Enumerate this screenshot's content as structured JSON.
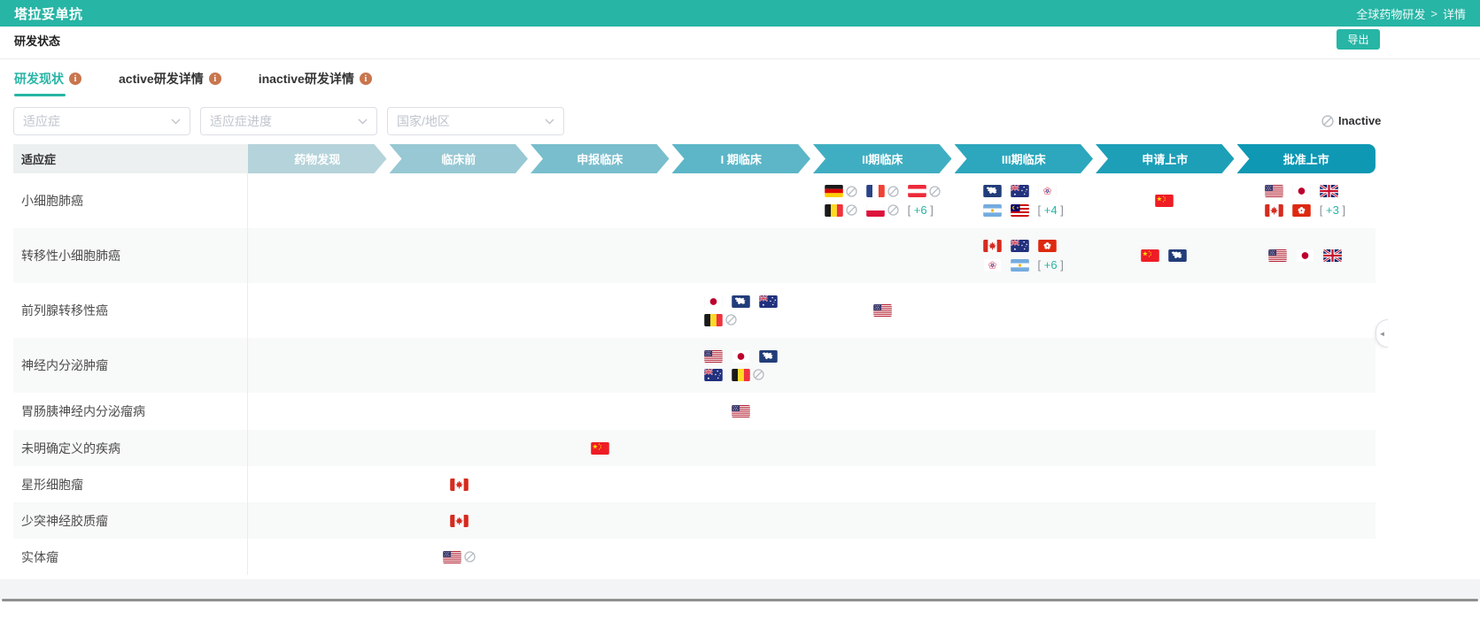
{
  "header": {
    "title": "塔拉妥单抗",
    "breadcrumb": {
      "parent": "全球药物研发",
      "separator": ">",
      "current": "详情"
    }
  },
  "toolbar": {
    "section_title": "研发状态",
    "export_label": "导出"
  },
  "tabs": [
    {
      "label": "研发现状",
      "active": true
    },
    {
      "label": "active研发详情",
      "active": false
    },
    {
      "label": "inactive研发详情",
      "active": false
    }
  ],
  "filters": [
    {
      "placeholder": "适应症"
    },
    {
      "placeholder": "适应症进度"
    },
    {
      "placeholder": "国家/地区"
    }
  ],
  "legend": {
    "inactive_label": "Inactive"
  },
  "colors": {
    "accent": "#27b5a5",
    "info_icon": "#c9764e",
    "inactive_gray": "#b6bcc3",
    "phase_colors": [
      "#b5d3da",
      "#97c8d3",
      "#79becd",
      "#5cb6c7",
      "#40aec2",
      "#2ca7bd",
      "#1d9fb8",
      "#0e98b4"
    ]
  },
  "table": {
    "indication_header": "适应症",
    "phases": [
      "药物发现",
      "临床前",
      "申报临床",
      "I 期临床",
      "II期临床",
      "III期临床",
      "申请上市",
      "批准上市"
    ],
    "flag_names": {
      "de": "Germany",
      "fr": "France",
      "at": "Austria",
      "be": "Belgium",
      "pl": "Poland",
      "eu": "European Union",
      "au": "Australia",
      "tw": "Chinese Taipei",
      "ar": "Argentina",
      "my": "Malaysia",
      "cn": "China",
      "us": "United States",
      "jp": "Japan",
      "gb": "United Kingdom",
      "ca": "Canada",
      "hk": "Hong Kong"
    },
    "rows": [
      {
        "label": "小细胞肺癌",
        "cells": {
          "4": [
            {
              "flag": "de",
              "inactive": true
            },
            {
              "flag": "fr",
              "inactive": true
            },
            {
              "flag": "at",
              "inactive": true
            },
            {
              "flag": "be",
              "inactive": true
            },
            {
              "flag": "pl",
              "inactive": true
            },
            {
              "more": "+6"
            }
          ],
          "5": [
            {
              "flag": "eu"
            },
            {
              "flag": "au"
            },
            {
              "flag": "tw"
            },
            {
              "flag": "ar"
            },
            {
              "flag": "my"
            },
            {
              "more": "+4"
            }
          ],
          "6": [
            {
              "flag": "cn"
            }
          ],
          "7": [
            {
              "flag": "us"
            },
            {
              "flag": "jp"
            },
            {
              "flag": "gb"
            },
            {
              "flag": "ca"
            },
            {
              "flag": "hk"
            },
            {
              "more": "+3"
            }
          ]
        }
      },
      {
        "label": "转移性小细胞肺癌",
        "cells": {
          "5": [
            {
              "flag": "ca"
            },
            {
              "flag": "au"
            },
            {
              "flag": "hk"
            },
            {
              "flag": "tw"
            },
            {
              "flag": "ar"
            },
            {
              "more": "+6"
            }
          ],
          "6": [
            {
              "flag": "cn"
            },
            {
              "flag": "eu"
            }
          ],
          "7": [
            {
              "flag": "us"
            },
            {
              "flag": "jp"
            },
            {
              "flag": "gb"
            }
          ]
        }
      },
      {
        "label": "前列腺转移性癌",
        "cells": {
          "3": [
            {
              "flag": "jp"
            },
            {
              "flag": "eu"
            },
            {
              "flag": "au"
            },
            {
              "flag": "be",
              "inactive": true
            }
          ],
          "4": [
            {
              "flag": "us"
            }
          ]
        }
      },
      {
        "label": "神经内分泌肿瘤",
        "cells": {
          "3": [
            {
              "flag": "us"
            },
            {
              "flag": "jp"
            },
            {
              "flag": "eu"
            },
            {
              "flag": "au"
            },
            {
              "flag": "be",
              "inactive": true
            }
          ]
        }
      },
      {
        "label": "胃肠胰神经内分泌瘤病",
        "cells": {
          "3": [
            {
              "flag": "us"
            }
          ]
        }
      },
      {
        "label": "未明确定义的疾病",
        "cells": {
          "2": [
            {
              "flag": "cn"
            }
          ]
        }
      },
      {
        "label": "星形细胞瘤",
        "cells": {
          "1": [
            {
              "flag": "ca"
            }
          ]
        }
      },
      {
        "label": "少突神经胶质瘤",
        "cells": {
          "1": [
            {
              "flag": "ca"
            }
          ]
        }
      },
      {
        "label": "实体瘤",
        "cells": {
          "1": [
            {
              "flag": "us",
              "inactive": true
            }
          ]
        }
      }
    ]
  },
  "side_handle": {
    "arrow": "◄"
  }
}
